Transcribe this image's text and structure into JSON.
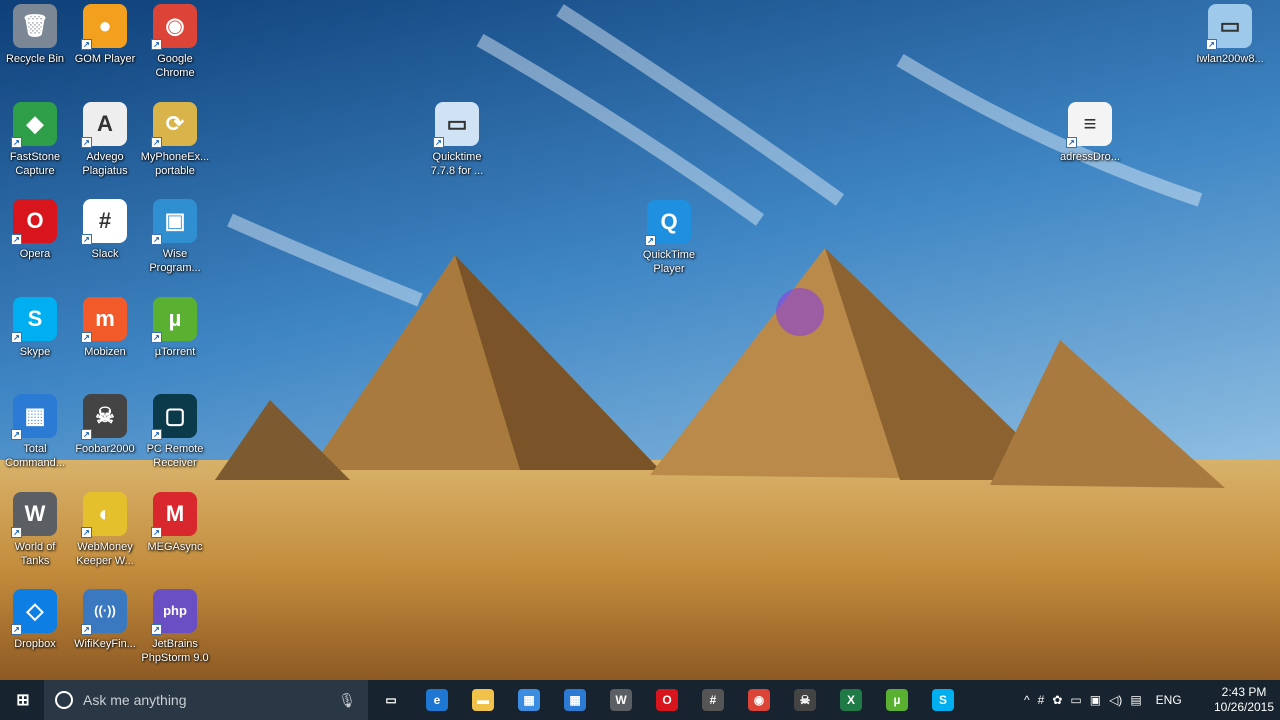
{
  "desktop_icons": [
    {
      "label": "Recycle Bin",
      "glyph": "🗑",
      "color": "#7b8794"
    },
    {
      "label": "GOM Player",
      "glyph": "●",
      "color": "#f2a01e"
    },
    {
      "label": "Google Chrome",
      "glyph": "◉",
      "color": "#db4437"
    },
    {
      "label": "FastStone Capture",
      "glyph": "◆",
      "color": "#2e9e48"
    },
    {
      "label": "Advego Plagiatus",
      "glyph": "A",
      "color": "#eeeeee"
    },
    {
      "label": "MyPhoneEx... portable",
      "glyph": "⟳",
      "color": "#d8b44a"
    },
    {
      "label": "Opera",
      "glyph": "O",
      "color": "#d8141d"
    },
    {
      "label": "Slack",
      "glyph": "#",
      "color": "#ffffff"
    },
    {
      "label": "Wise Program...",
      "glyph": "▣",
      "color": "#2f8fd0"
    },
    {
      "label": "Skype",
      "glyph": "S",
      "color": "#00aff0"
    },
    {
      "label": "Mobizen",
      "glyph": "m",
      "color": "#f25a29"
    },
    {
      "label": "µTorrent",
      "glyph": "µ",
      "color": "#5ab031"
    },
    {
      "label": "Total Command...",
      "glyph": "▦",
      "color": "#2b7bd4"
    },
    {
      "label": "Foobar2000",
      "glyph": "☠",
      "color": "#444444"
    },
    {
      "label": "PC Remote Receiver",
      "glyph": "▢",
      "color": "#0b3b4a"
    },
    {
      "label": "World of Tanks",
      "glyph": "W",
      "color": "#5b5f63"
    },
    {
      "label": "WebMoney Keeper W...",
      "glyph": "◐",
      "color": "#e5c02d"
    },
    {
      "label": "MEGAsync",
      "glyph": "M",
      "color": "#d9272e"
    },
    {
      "label": "Dropbox",
      "glyph": "◇",
      "color": "#0d7ee3"
    },
    {
      "label": "WifiKeyFin...",
      "glyph": "((·))",
      "color": "#3a78c0"
    },
    {
      "label": "JetBrains PhpStorm 9.0",
      "glyph": "php",
      "color": "#6a4fc4"
    },
    {
      "label": "Quicktime 7.7.8 for ...",
      "glyph": "▭",
      "color": "#cfe3f5"
    },
    {
      "label": "QuickTime Player",
      "glyph": "Q",
      "color": "#1f8fe0"
    },
    {
      "label": "Iwlan200w8...",
      "glyph": "▭",
      "color": "#9ec9ea"
    },
    {
      "label": "adressDro...",
      "glyph": "≡",
      "color": "#f4f4f4"
    }
  ],
  "taskbar": {
    "search_placeholder": "Ask me anything",
    "apps": [
      {
        "name": "task-view",
        "glyph": "▭",
        "color": "transparent"
      },
      {
        "name": "edge",
        "glyph": "e",
        "color": "#1e77d2"
      },
      {
        "name": "file-explorer",
        "glyph": "▬",
        "color": "#f0c24a"
      },
      {
        "name": "store",
        "glyph": "▦",
        "color": "#3a8de0"
      },
      {
        "name": "total-commander",
        "glyph": "▦",
        "color": "#2b7bd4"
      },
      {
        "name": "world-of-tanks",
        "glyph": "W",
        "color": "#5b5f63"
      },
      {
        "name": "opera",
        "glyph": "O",
        "color": "#d8141d"
      },
      {
        "name": "slack",
        "glyph": "#",
        "color": "#555555"
      },
      {
        "name": "chrome",
        "glyph": "◉",
        "color": "#db4437"
      },
      {
        "name": "foobar2000",
        "glyph": "☠",
        "color": "#444444"
      },
      {
        "name": "excel",
        "glyph": "X",
        "color": "#1f7a45"
      },
      {
        "name": "utorrent",
        "glyph": "µ",
        "color": "#5ab031"
      },
      {
        "name": "skype",
        "glyph": "S",
        "color": "#00aff0"
      }
    ],
    "language": "ENG",
    "time": "2:43 PM",
    "date": "10/26/2015"
  }
}
